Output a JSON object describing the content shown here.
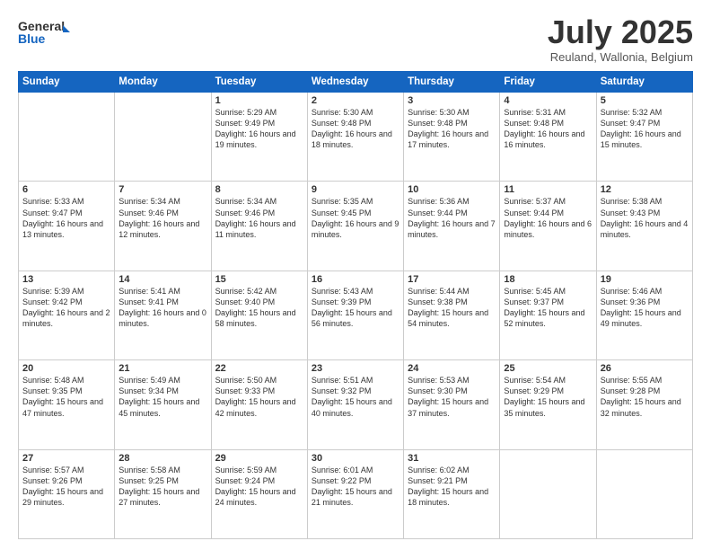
{
  "header": {
    "logo_line1": "General",
    "logo_line2": "Blue",
    "month": "July 2025",
    "location": "Reuland, Wallonia, Belgium"
  },
  "weekdays": [
    "Sunday",
    "Monday",
    "Tuesday",
    "Wednesday",
    "Thursday",
    "Friday",
    "Saturday"
  ],
  "weeks": [
    [
      {
        "day": "",
        "info": ""
      },
      {
        "day": "",
        "info": ""
      },
      {
        "day": "1",
        "info": "Sunrise: 5:29 AM\nSunset: 9:49 PM\nDaylight: 16 hours\nand 19 minutes."
      },
      {
        "day": "2",
        "info": "Sunrise: 5:30 AM\nSunset: 9:48 PM\nDaylight: 16 hours\nand 18 minutes."
      },
      {
        "day": "3",
        "info": "Sunrise: 5:30 AM\nSunset: 9:48 PM\nDaylight: 16 hours\nand 17 minutes."
      },
      {
        "day": "4",
        "info": "Sunrise: 5:31 AM\nSunset: 9:48 PM\nDaylight: 16 hours\nand 16 minutes."
      },
      {
        "day": "5",
        "info": "Sunrise: 5:32 AM\nSunset: 9:47 PM\nDaylight: 16 hours\nand 15 minutes."
      }
    ],
    [
      {
        "day": "6",
        "info": "Sunrise: 5:33 AM\nSunset: 9:47 PM\nDaylight: 16 hours\nand 13 minutes."
      },
      {
        "day": "7",
        "info": "Sunrise: 5:34 AM\nSunset: 9:46 PM\nDaylight: 16 hours\nand 12 minutes."
      },
      {
        "day": "8",
        "info": "Sunrise: 5:34 AM\nSunset: 9:46 PM\nDaylight: 16 hours\nand 11 minutes."
      },
      {
        "day": "9",
        "info": "Sunrise: 5:35 AM\nSunset: 9:45 PM\nDaylight: 16 hours\nand 9 minutes."
      },
      {
        "day": "10",
        "info": "Sunrise: 5:36 AM\nSunset: 9:44 PM\nDaylight: 16 hours\nand 7 minutes."
      },
      {
        "day": "11",
        "info": "Sunrise: 5:37 AM\nSunset: 9:44 PM\nDaylight: 16 hours\nand 6 minutes."
      },
      {
        "day": "12",
        "info": "Sunrise: 5:38 AM\nSunset: 9:43 PM\nDaylight: 16 hours\nand 4 minutes."
      }
    ],
    [
      {
        "day": "13",
        "info": "Sunrise: 5:39 AM\nSunset: 9:42 PM\nDaylight: 16 hours\nand 2 minutes."
      },
      {
        "day": "14",
        "info": "Sunrise: 5:41 AM\nSunset: 9:41 PM\nDaylight: 16 hours\nand 0 minutes."
      },
      {
        "day": "15",
        "info": "Sunrise: 5:42 AM\nSunset: 9:40 PM\nDaylight: 15 hours\nand 58 minutes."
      },
      {
        "day": "16",
        "info": "Sunrise: 5:43 AM\nSunset: 9:39 PM\nDaylight: 15 hours\nand 56 minutes."
      },
      {
        "day": "17",
        "info": "Sunrise: 5:44 AM\nSunset: 9:38 PM\nDaylight: 15 hours\nand 54 minutes."
      },
      {
        "day": "18",
        "info": "Sunrise: 5:45 AM\nSunset: 9:37 PM\nDaylight: 15 hours\nand 52 minutes."
      },
      {
        "day": "19",
        "info": "Sunrise: 5:46 AM\nSunset: 9:36 PM\nDaylight: 15 hours\nand 49 minutes."
      }
    ],
    [
      {
        "day": "20",
        "info": "Sunrise: 5:48 AM\nSunset: 9:35 PM\nDaylight: 15 hours\nand 47 minutes."
      },
      {
        "day": "21",
        "info": "Sunrise: 5:49 AM\nSunset: 9:34 PM\nDaylight: 15 hours\nand 45 minutes."
      },
      {
        "day": "22",
        "info": "Sunrise: 5:50 AM\nSunset: 9:33 PM\nDaylight: 15 hours\nand 42 minutes."
      },
      {
        "day": "23",
        "info": "Sunrise: 5:51 AM\nSunset: 9:32 PM\nDaylight: 15 hours\nand 40 minutes."
      },
      {
        "day": "24",
        "info": "Sunrise: 5:53 AM\nSunset: 9:30 PM\nDaylight: 15 hours\nand 37 minutes."
      },
      {
        "day": "25",
        "info": "Sunrise: 5:54 AM\nSunset: 9:29 PM\nDaylight: 15 hours\nand 35 minutes."
      },
      {
        "day": "26",
        "info": "Sunrise: 5:55 AM\nSunset: 9:28 PM\nDaylight: 15 hours\nand 32 minutes."
      }
    ],
    [
      {
        "day": "27",
        "info": "Sunrise: 5:57 AM\nSunset: 9:26 PM\nDaylight: 15 hours\nand 29 minutes."
      },
      {
        "day": "28",
        "info": "Sunrise: 5:58 AM\nSunset: 9:25 PM\nDaylight: 15 hours\nand 27 minutes."
      },
      {
        "day": "29",
        "info": "Sunrise: 5:59 AM\nSunset: 9:24 PM\nDaylight: 15 hours\nand 24 minutes."
      },
      {
        "day": "30",
        "info": "Sunrise: 6:01 AM\nSunset: 9:22 PM\nDaylight: 15 hours\nand 21 minutes."
      },
      {
        "day": "31",
        "info": "Sunrise: 6:02 AM\nSunset: 9:21 PM\nDaylight: 15 hours\nand 18 minutes."
      },
      {
        "day": "",
        "info": ""
      },
      {
        "day": "",
        "info": ""
      }
    ]
  ]
}
